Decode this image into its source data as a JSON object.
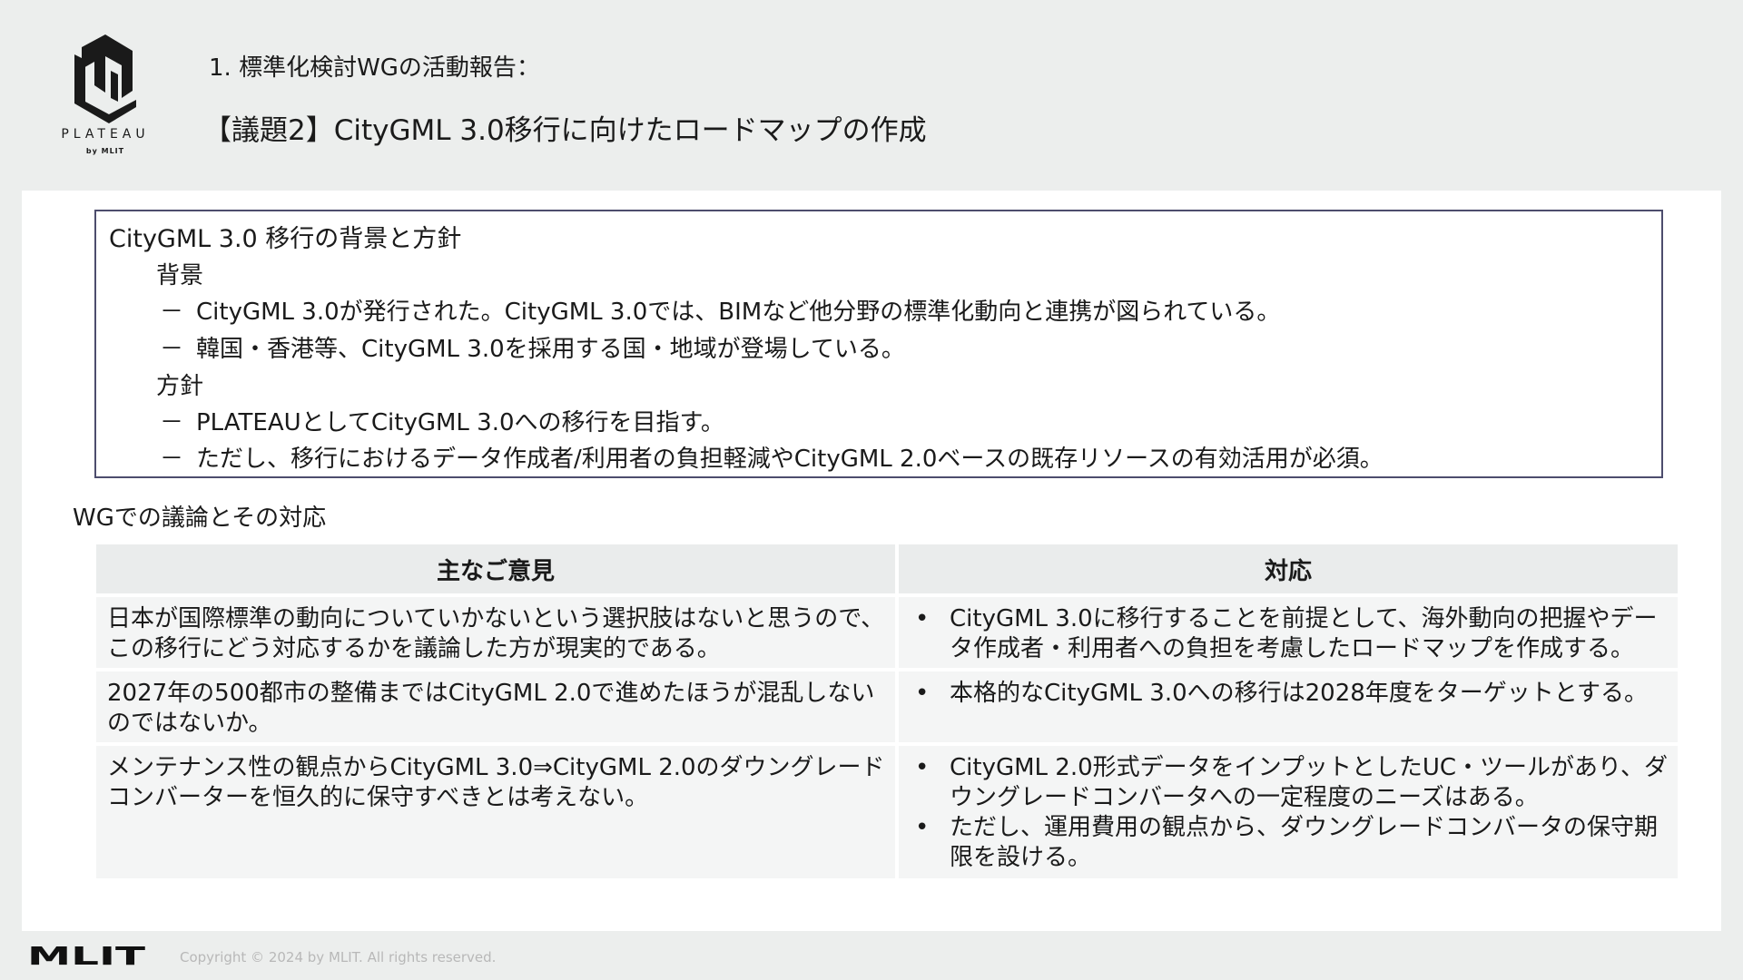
{
  "logo": {
    "name": "PLATEAU",
    "sub": "by MLIT"
  },
  "header": {
    "subtitle": "1. 標準化検討WGの活動報告：",
    "title": "【議題2】CityGML 3.0移行に向けたロードマップの作成"
  },
  "box": {
    "title": "CityGML 3.0 移行の背景と方針",
    "background_heading": "背景",
    "background_items": [
      "CityGML 3.0が発行された。CityGML 3.0では、BIMなど他分野の標準化動向と連携が図られている。",
      "韓国・香港等、CityGML 3.0を採用する国・地域が登場している。"
    ],
    "policy_heading": "方針",
    "policy_items": [
      "PLATEAUとしてCityGML 3.0への移行を目指す。",
      "ただし、移行におけるデータ作成者/利用者の負担軽減やCityGML 2.0ベースの既存リソースの有効活用が必須。"
    ],
    "dash": "－"
  },
  "section_label": "WGでの議論とその対応",
  "table": {
    "headers": [
      "主なご意見",
      "対応"
    ],
    "bullet": "•",
    "rows": [
      {
        "opinion": "日本が国際標準の動向についていかないという選択肢はないと思うので、この移行にどう対応するかを議論した方が現実的である。",
        "responses": [
          "CityGML 3.0に移行することを前提として、海外動向の把握やデータ作成者・利用者への負担を考慮したロードマップを作成する。"
        ]
      },
      {
        "opinion": "2027年の500都市の整備まではCityGML 2.0で進めたほうが混乱しないのではないか。",
        "responses": [
          "本格的なCityGML 3.0への移行は2028年度をターゲットとする。"
        ]
      },
      {
        "opinion": "メンテナンス性の観点からCityGML 3.0⇒CityGML 2.0のダウングレードコンバーターを恒久的に保守すべきとは考えない。",
        "responses": [
          "CityGML 2.0形式データをインプットとしたUC・ツールがあり、ダウングレードコンバータへの一定程度のニーズはある。",
          "ただし、運用費用の観点から、ダウングレードコンバータの保守期限を設ける。"
        ]
      }
    ]
  },
  "footer": {
    "logo_text": "MLIT",
    "copyright": "Copyright © 2024 by MLIT. All rights reserved."
  }
}
